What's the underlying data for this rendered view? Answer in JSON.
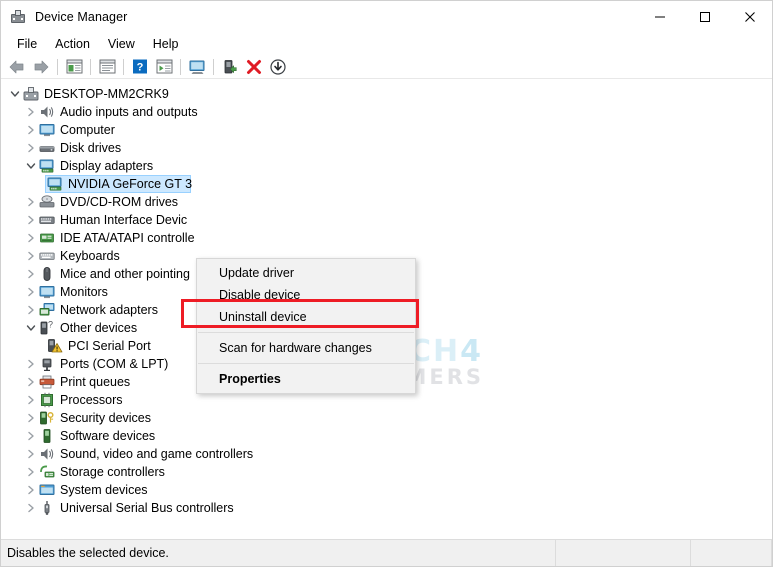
{
  "window": {
    "title": "Device Manager",
    "icon": "device-manager-icon",
    "controls": {
      "minimize": "minimize-icon",
      "maximize": "maximize-icon",
      "close": "close-icon"
    }
  },
  "menubar": {
    "items": [
      {
        "label": "File"
      },
      {
        "label": "Action"
      },
      {
        "label": "View"
      },
      {
        "label": "Help"
      }
    ]
  },
  "toolbar": {
    "items": [
      {
        "name": "back-icon"
      },
      {
        "name": "forward-icon"
      },
      {
        "name": "separator"
      },
      {
        "name": "show-hide-console-tree-icon"
      },
      {
        "name": "separator"
      },
      {
        "name": "properties-icon"
      },
      {
        "name": "separator"
      },
      {
        "name": "help-icon"
      },
      {
        "name": "update-driver-icon"
      },
      {
        "name": "separator"
      },
      {
        "name": "scan-for-hardware-changes-icon"
      },
      {
        "name": "separator"
      },
      {
        "name": "enable-device-icon"
      },
      {
        "name": "uninstall-device-icon"
      },
      {
        "name": "disable-device-icon"
      }
    ]
  },
  "tree": {
    "nodes": [
      {
        "label": "DESKTOP-MM2CRK9",
        "level": 0,
        "state": "expanded",
        "icon": "computer-root-icon",
        "selected": false
      },
      {
        "label": "Audio inputs and outputs",
        "level": 1,
        "state": "collapsed",
        "icon": "speaker-icon",
        "selected": false
      },
      {
        "label": "Computer",
        "level": 1,
        "state": "collapsed",
        "icon": "monitor-icon",
        "selected": false
      },
      {
        "label": "Disk drives",
        "level": 1,
        "state": "collapsed",
        "icon": "disk-drive-icon",
        "selected": false
      },
      {
        "label": "Display adapters",
        "level": 1,
        "state": "expanded",
        "icon": "display-adapter-icon",
        "selected": false
      },
      {
        "label": "NVIDIA GeForce GT 3",
        "level": 2,
        "state": "leaf",
        "icon": "display-adapter-icon",
        "selected": true
      },
      {
        "label": "DVD/CD-ROM drives",
        "level": 1,
        "state": "collapsed",
        "icon": "dvd-drive-icon",
        "selected": false
      },
      {
        "label": "Human Interface Devic",
        "level": 1,
        "state": "collapsed",
        "icon": "hid-icon",
        "selected": false
      },
      {
        "label": "IDE ATA/ATAPI controlle",
        "level": 1,
        "state": "collapsed",
        "icon": "ide-controller-icon",
        "selected": false
      },
      {
        "label": "Keyboards",
        "level": 1,
        "state": "collapsed",
        "icon": "keyboard-icon",
        "selected": false
      },
      {
        "label": "Mice and other pointing",
        "level": 1,
        "state": "collapsed",
        "icon": "mouse-icon",
        "selected": false
      },
      {
        "label": "Monitors",
        "level": 1,
        "state": "collapsed",
        "icon": "monitor-icon",
        "selected": false
      },
      {
        "label": "Network adapters",
        "level": 1,
        "state": "collapsed",
        "icon": "network-adapter-icon",
        "selected": false
      },
      {
        "label": "Other devices",
        "level": 1,
        "state": "expanded",
        "icon": "unknown-device-icon",
        "selected": false
      },
      {
        "label": "PCI Serial Port",
        "level": 2,
        "state": "leaf",
        "icon": "unknown-device-warning-icon",
        "selected": false
      },
      {
        "label": "Ports (COM & LPT)",
        "level": 1,
        "state": "collapsed",
        "icon": "port-icon",
        "selected": false
      },
      {
        "label": "Print queues",
        "level": 1,
        "state": "collapsed",
        "icon": "printer-icon",
        "selected": false
      },
      {
        "label": "Processors",
        "level": 1,
        "state": "collapsed",
        "icon": "processor-icon",
        "selected": false
      },
      {
        "label": "Security devices",
        "level": 1,
        "state": "collapsed",
        "icon": "security-device-icon",
        "selected": false
      },
      {
        "label": "Software devices",
        "level": 1,
        "state": "collapsed",
        "icon": "software-device-icon",
        "selected": false
      },
      {
        "label": "Sound, video and game controllers",
        "level": 1,
        "state": "collapsed",
        "icon": "speaker-icon",
        "selected": false
      },
      {
        "label": "Storage controllers",
        "level": 1,
        "state": "collapsed",
        "icon": "storage-controller-icon",
        "selected": false
      },
      {
        "label": "System devices",
        "level": 1,
        "state": "collapsed",
        "icon": "system-device-icon",
        "selected": false
      },
      {
        "label": "Universal Serial Bus controllers",
        "level": 1,
        "state": "collapsed",
        "icon": "usb-icon",
        "selected": false
      }
    ]
  },
  "context_menu": {
    "items": [
      {
        "label": "Update driver",
        "type": "item",
        "bold": false
      },
      {
        "label": "Disable device",
        "type": "item",
        "bold": false
      },
      {
        "label": "Uninstall device",
        "type": "item",
        "bold": false,
        "highlighted": true
      },
      {
        "type": "separator"
      },
      {
        "label": "Scan for hardware changes",
        "type": "item",
        "bold": false
      },
      {
        "type": "separator"
      },
      {
        "label": "Properties",
        "type": "item",
        "bold": true
      }
    ],
    "highlight_color": "#ee1c25"
  },
  "watermark": {
    "line1_a": "TECH",
    "line1_b": "4",
    "line2": "GAMERS"
  },
  "statusbar": {
    "message": "Disables the selected device.",
    "pane2": "",
    "pane3": ""
  }
}
